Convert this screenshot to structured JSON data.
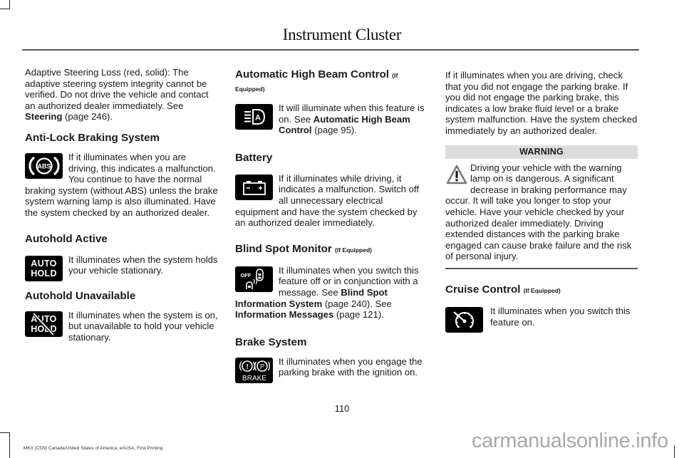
{
  "header": {
    "title": "Instrument Cluster"
  },
  "left_column": {
    "intro": {
      "text": "Adaptive Steering Loss (red, solid): The adaptive steering system integrity cannot be verified. Do not drive the vehicle and contact an authorized dealer immediately.  See ",
      "link": "Steering",
      "page_ref": " (page 246)."
    },
    "abs": {
      "heading": "Anti-Lock Braking System",
      "icon": "abs-warning-icon",
      "icon_label": "ABS",
      "text": "If it illuminates when you are driving, this indicates a malfunction. You continue to have the normal braking system (without ABS) unless the brake system warning lamp is also illuminated. Have the system checked by an authorized dealer."
    },
    "autohold_active": {
      "heading": "Autohold Active",
      "icon_line1": "AUTO",
      "icon_line2": "HOLD",
      "text": "It illuminates when the system holds your vehicle stationary."
    },
    "autohold_unavailable": {
      "heading": "Autohold Unavailable",
      "icon_line1": "AUTO",
      "icon_line2": "HOLD",
      "text": "It illuminates when the system is on, but unavailable to hold your vehicle stationary."
    }
  },
  "middle_column": {
    "auto_high_beam": {
      "heading": "Automatic High Beam Control",
      "qualifier": "(If Equipped)",
      "icon_label": "A",
      "text": "It will illuminate when this feature is on.  See ",
      "link": "Automatic High Beam Control",
      "page_ref": " (page 95)."
    },
    "battery": {
      "heading": "Battery",
      "text": "If it illuminates while driving, it indicates a malfunction. Switch off all unnecessary electrical equipment and have the system checked by an authorized dealer immediately."
    },
    "blind_spot": {
      "heading": "Blind Spot Monitor",
      "qualifier": "(If Equipped)",
      "icon_label": "OFF",
      "text": "It illuminates when you switch this feature off or in conjunction with a message.  See ",
      "link1": "Blind Spot Information System",
      "page_ref1": " (page 240).   See ",
      "link2": "Information Messages",
      "page_ref2": " (page 121)."
    },
    "brake_system": {
      "heading": "Brake System",
      "icon_excl": "!",
      "icon_p": "P",
      "icon_label": "BRAKE",
      "text": "It illuminates when you engage the parking brake with the ignition on."
    }
  },
  "right_column": {
    "brake_text": "If it illuminates when you are driving, check that you did not engage the parking brake. If you did not engage the parking brake, this indicates a low brake fluid level or a brake system malfunction. Have the system checked immediately by an authorized dealer.",
    "warning": {
      "title": "WARNING",
      "text": "Driving your vehicle with the warning lamp on is dangerous. A significant decrease in braking performance may occur. It will take you longer to stop your vehicle. Have your vehicle checked by your authorized dealer immediately. Driving extended distances with the parking brake engaged can cause brake failure and the risk of personal injury."
    },
    "cruise": {
      "heading": "Cruise Control",
      "qualifier": "(If Equipped)",
      "text": "It illuminates when you switch this feature on."
    }
  },
  "footer": {
    "page_number": "110",
    "edition": "MKX (CD9) Canada/United States of America, enUSA, First Printing",
    "watermark": "carmanualsonline.info"
  }
}
